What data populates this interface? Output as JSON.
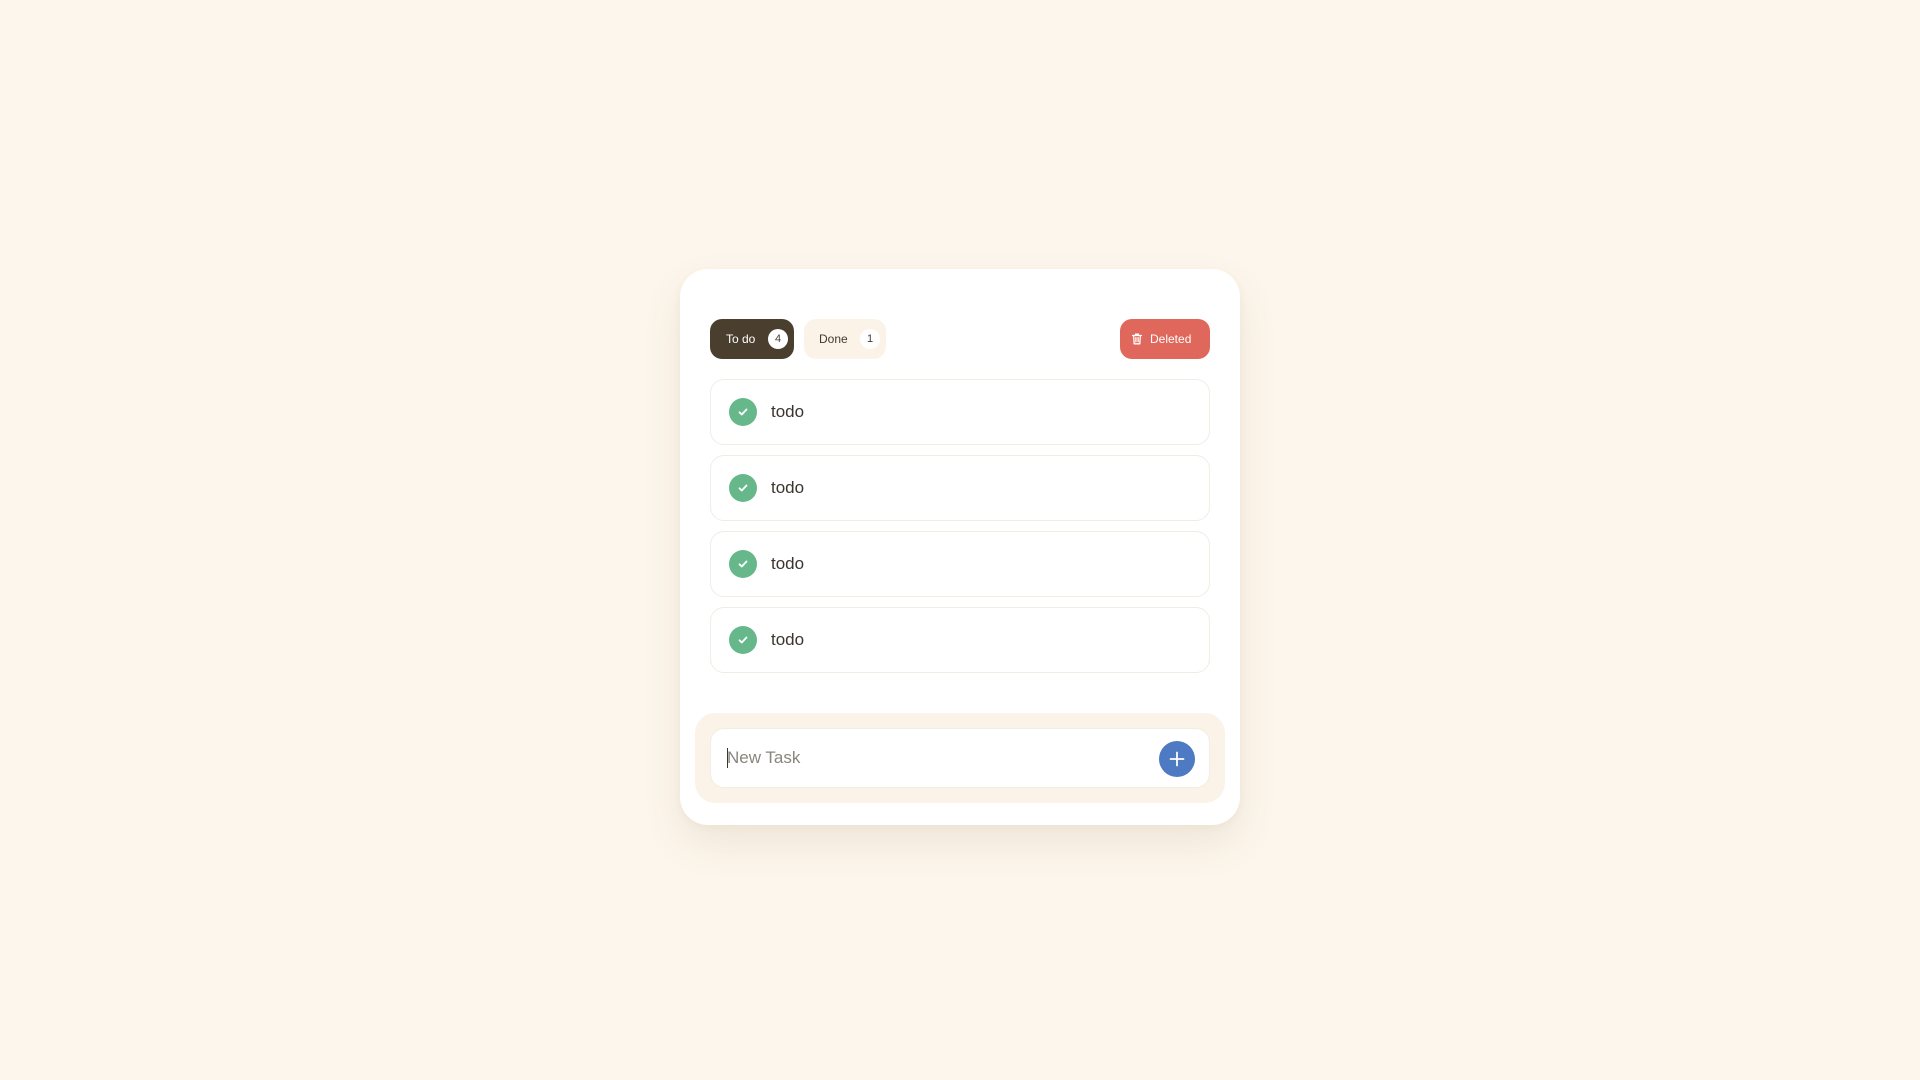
{
  "colors": {
    "background": "#fdf6ec",
    "tab_active": "#4a3f2f",
    "tab_inactive": "#fcf3e8",
    "deleted": "#e0675b",
    "check": "#66b88a",
    "add_button": "#4d7ac2"
  },
  "tabs": {
    "todo": {
      "label": "To do",
      "count": "4"
    },
    "done": {
      "label": "Done",
      "count": "1"
    },
    "deleted": {
      "label": "Deleted",
      "icon": "trash-icon"
    }
  },
  "tasks": [
    {
      "text": "todo",
      "icon": "check-icon"
    },
    {
      "text": "todo",
      "icon": "check-icon"
    },
    {
      "text": "todo",
      "icon": "check-icon"
    },
    {
      "text": "todo",
      "icon": "check-icon"
    }
  ],
  "composer": {
    "placeholder": "New Task",
    "value": "",
    "add_icon": "plus-icon"
  }
}
